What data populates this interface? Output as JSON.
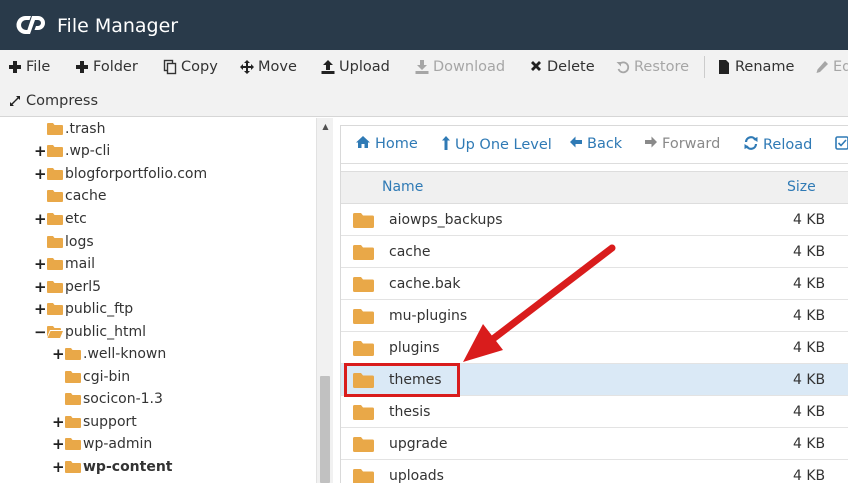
{
  "header": {
    "title": "File Manager",
    "logo_icon": "cpanel-logo-icon"
  },
  "toolbar": {
    "row1": [
      {
        "label": "File",
        "icon": "plus-icon",
        "enabled": true
      },
      {
        "label": "Folder",
        "icon": "plus-icon",
        "enabled": true
      },
      {
        "label": "Copy",
        "icon": "copy-icon",
        "enabled": true
      },
      {
        "label": "Move",
        "icon": "move-icon",
        "enabled": true
      },
      {
        "label": "Upload",
        "icon": "upload-icon",
        "enabled": true
      },
      {
        "label": "Download",
        "icon": "download-icon",
        "enabled": false
      },
      {
        "label": "Delete",
        "icon": "times-icon",
        "enabled": true
      },
      {
        "label": "Restore",
        "icon": "restore-icon",
        "enabled": false
      },
      {
        "label": "Rename",
        "icon": "file-icon",
        "enabled": true
      },
      {
        "label": "Ed",
        "icon": "pencil-icon",
        "enabled": false
      }
    ],
    "row2": [
      {
        "label": "Compress",
        "icon": "compress-icon",
        "enabled": true
      }
    ]
  },
  "tree": [
    {
      "label": ".trash",
      "toggle": ""
    },
    {
      "label": ".wp-cli",
      "toggle": "+"
    },
    {
      "label": "blogforportfolio.com",
      "toggle": "+"
    },
    {
      "label": "cache",
      "toggle": ""
    },
    {
      "label": "etc",
      "toggle": "+"
    },
    {
      "label": "logs",
      "toggle": ""
    },
    {
      "label": "mail",
      "toggle": "+"
    },
    {
      "label": "perl5",
      "toggle": "+"
    },
    {
      "label": "public_ftp",
      "toggle": "+"
    },
    {
      "label": "public_html",
      "toggle": "−"
    },
    {
      "label": ".well-known",
      "toggle": "+"
    },
    {
      "label": "cgi-bin",
      "toggle": ""
    },
    {
      "label": "socicon-1.3",
      "toggle": ""
    },
    {
      "label": "support",
      "toggle": "+"
    },
    {
      "label": "wp-admin",
      "toggle": "+"
    },
    {
      "label": "wp-content",
      "toggle": "+"
    }
  ],
  "nav": [
    {
      "label": "Home",
      "icon": "home-icon",
      "enabled": true
    },
    {
      "label": "Up One Level",
      "icon": "level-up-icon",
      "enabled": true
    },
    {
      "label": "Back",
      "icon": "arrow-left-icon",
      "enabled": true
    },
    {
      "label": "Forward",
      "icon": "arrow-right-icon",
      "enabled": false
    },
    {
      "label": "Reload",
      "icon": "reload-icon",
      "enabled": true
    }
  ],
  "table": {
    "columns": [
      "Name",
      "Size"
    ],
    "rows": [
      {
        "name": "aiowps_backups",
        "size": "4 KB"
      },
      {
        "name": "cache",
        "size": "4 KB"
      },
      {
        "name": "cache.bak",
        "size": "4 KB"
      },
      {
        "name": "mu-plugins",
        "size": "4 KB"
      },
      {
        "name": "plugins",
        "size": "4 KB"
      },
      {
        "name": "themes",
        "size": "4 KB"
      },
      {
        "name": "thesis",
        "size": "4 KB"
      },
      {
        "name": "upgrade",
        "size": "4 KB"
      },
      {
        "name": "uploads",
        "size": "4 KB"
      }
    ]
  },
  "colors": {
    "header_bg": "#293a4a",
    "link_blue": "#2f7ab5",
    "folder_orange": "#e9a848",
    "selected_row": "#dae9f6",
    "annotation_red": "#d91c1c"
  }
}
